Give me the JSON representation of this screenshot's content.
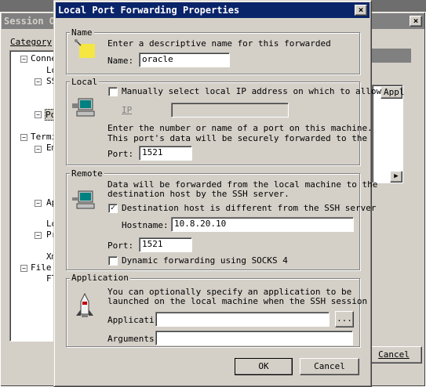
{
  "background_window": {
    "title": "Session O",
    "category_label": "Category",
    "tree": [
      {
        "label": "Conne",
        "expander": "−"
      },
      {
        "label": "Lo"
      },
      {
        "label": "SS",
        "expander": "−"
      },
      {
        "label": "Po",
        "expander": "−"
      },
      {
        "label": "Termi",
        "expander": "−"
      },
      {
        "label": "Em",
        "expander": "−"
      },
      {
        "label": "Ap",
        "expander": "−"
      },
      {
        "label": "Lo"
      },
      {
        "label": "Pr",
        "expander": "−"
      },
      {
        "label": "Xm"
      },
      {
        "label": "File",
        "expander": "−"
      },
      {
        "label": "FT"
      }
    ],
    "column_header": "Appl",
    "cancel_label": "Cancel",
    "close_glyph": "×"
  },
  "dialog": {
    "title": "Local Port Forwarding Properties",
    "close_glyph": "×",
    "name_group": {
      "title": "Name",
      "description": "Enter a descriptive name for this forwarded",
      "name_label": "Name:",
      "name_value": "oracle"
    },
    "local_group": {
      "title": "Local",
      "manual_ip_label": "Manually select local IP address on which to allow",
      "manual_ip_checked": false,
      "ip_label": "IP",
      "ip_value": "",
      "port_desc_line1": "Enter the number or name of a port on this machine.",
      "port_desc_line2": "This port's data will be securely forwarded to the",
      "port_label": "Port:",
      "port_value": "1521"
    },
    "remote_group": {
      "title": "Remote",
      "desc_line1": "Data will be forwarded from the local machine to the",
      "desc_line2": "destination host by the SSH server.",
      "dest_diff_label": "Destination host is different from the SSH server",
      "dest_diff_checked": true,
      "hostname_label": "Hostname:",
      "hostname_value": "10.8.20.10",
      "port_label": "Port:",
      "port_value": "1521",
      "dynamic_label": "Dynamic forwarding using SOCKS 4",
      "dynamic_checked": false
    },
    "application_group": {
      "title": "Application",
      "desc_line1": "You can optionally specify an application to be",
      "desc_line2": "launched on the local machine when the SSH session",
      "application_label": "Applicati",
      "application_value": "",
      "browse_label": "...",
      "arguments_label": "Arguments",
      "arguments_value": ""
    },
    "ok_label": "OK",
    "cancel_label": "Cancel"
  }
}
